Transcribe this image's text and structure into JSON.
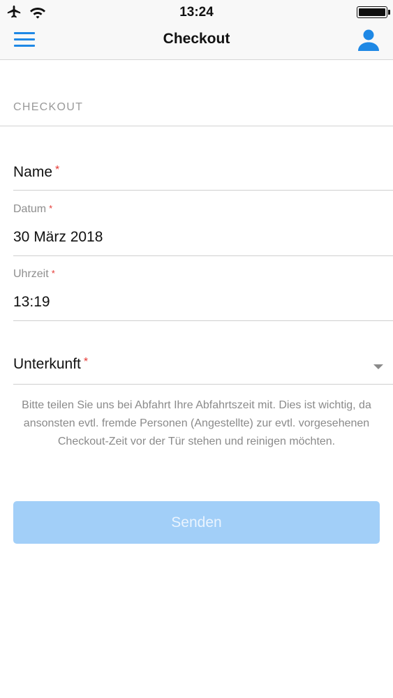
{
  "status_bar": {
    "time": "13:24",
    "icons": [
      "airplane-icon",
      "wifi-icon",
      "battery-icon"
    ]
  },
  "nav": {
    "title": "Checkout",
    "left_icon": "menu-icon",
    "right_icon": "user-icon"
  },
  "section": {
    "header": "CHECKOUT"
  },
  "form": {
    "name": {
      "label": "Name",
      "required_mark": "*",
      "value": ""
    },
    "datum": {
      "label": "Datum",
      "required_mark": "*",
      "value": "30 März 2018"
    },
    "uhrzeit": {
      "label": "Uhrzeit",
      "required_mark": "*",
      "value": "13:19"
    },
    "unterkunft": {
      "label": "Unterkunft",
      "required_mark": "*",
      "value": ""
    }
  },
  "help_text": "Bitte teilen Sie uns bei Abfahrt Ihre Abfahrtszeit mit. Dies ist wichtig, da ansonsten evtl. fremde Personen (Angestellte) zur evtl. vorgesehenen Checkout-Zeit vor der Tür stehen und reinigen möchten.",
  "submit": {
    "label": "Senden",
    "enabled": false
  },
  "colors": {
    "accent": "#1e88e5",
    "required": "#e53935",
    "submit_disabled": "#a2cff8",
    "muted_text": "#8e8e8e"
  }
}
